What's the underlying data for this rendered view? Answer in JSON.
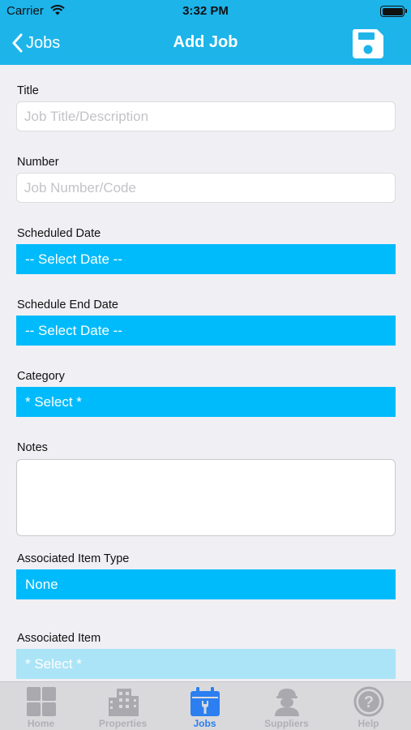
{
  "status_bar": {
    "carrier": "Carrier",
    "time": "3:32 PM"
  },
  "nav": {
    "back_label": "Jobs",
    "title": "Add Job"
  },
  "form": {
    "title": {
      "label": "Title",
      "placeholder": "Job Title/Description",
      "value": ""
    },
    "number": {
      "label": "Number",
      "placeholder": "Job Number/Code",
      "value": ""
    },
    "scheduled_date": {
      "label": "Scheduled Date",
      "value": "-- Select Date --"
    },
    "schedule_end_date": {
      "label": "Schedule End Date",
      "value": "-- Select Date --"
    },
    "category": {
      "label": "Category",
      "value": "* Select *"
    },
    "notes": {
      "label": "Notes",
      "value": ""
    },
    "associated_item_type": {
      "label": "Associated Item Type",
      "value": "None"
    },
    "associated_item": {
      "label": "Associated Item",
      "value": "* Select *"
    }
  },
  "tabs": [
    {
      "label": "Home",
      "icon": "grid-icon",
      "active": false
    },
    {
      "label": "Properties",
      "icon": "building-icon",
      "active": false
    },
    {
      "label": "Jobs",
      "icon": "calendar-wrench-icon",
      "active": true
    },
    {
      "label": "Suppliers",
      "icon": "worker-icon",
      "active": false
    },
    {
      "label": "Help",
      "icon": "question-icon",
      "active": false
    }
  ],
  "colors": {
    "nav_background": "#1db4ea",
    "select_background": "#00bbfb",
    "select_disabled_background": "#abe4f6",
    "tab_active": "#2b7ff0",
    "tab_inactive": "#b0b0b5",
    "page_background": "#efeff4"
  }
}
